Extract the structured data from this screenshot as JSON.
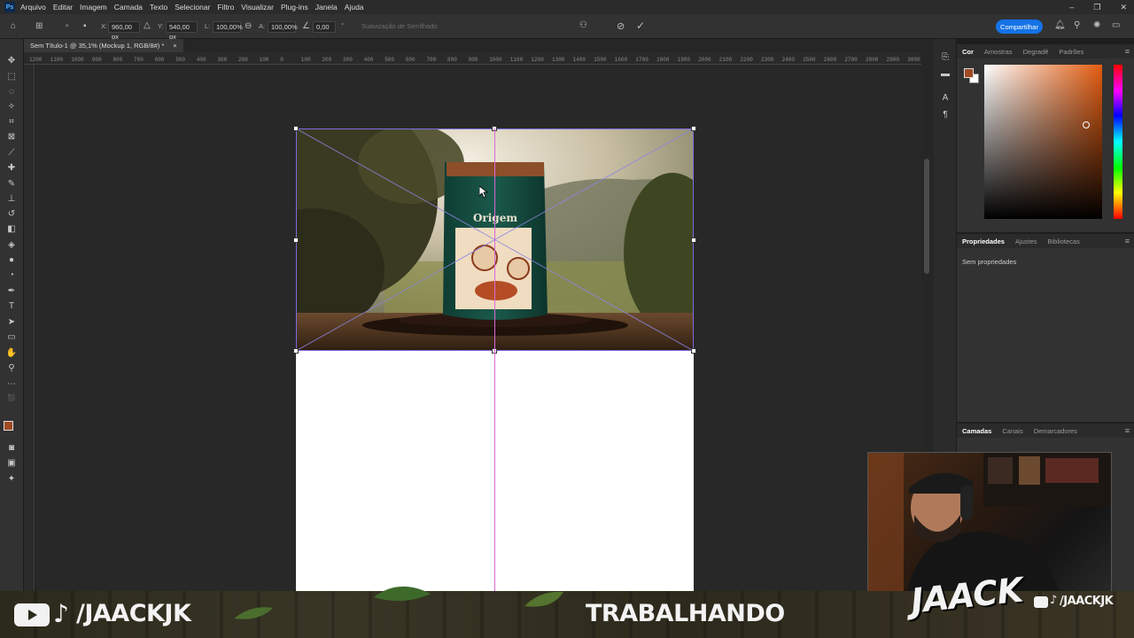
{
  "menu": {
    "logo": "Ps",
    "items": [
      "Arquivo",
      "Editar",
      "Imagem",
      "Camada",
      "Texto",
      "Selecionar",
      "Filtro",
      "Visualizar",
      "Plug-ins",
      "Janela",
      "Ajuda"
    ]
  },
  "window_controls": {
    "minimize": "–",
    "restore": "❐",
    "close": "✕"
  },
  "options": {
    "x_label": "X:",
    "x_value": "960,00 px",
    "y_label": "Y:",
    "y_value": "540,00 px",
    "w_label": "L:",
    "w_value": "100,00%",
    "h_label": "A:",
    "h_value": "100,00%",
    "angle_value": "0,00",
    "degree": "°",
    "smoothing": "Suavização de Serrilhado",
    "share": "Compartilhar"
  },
  "document": {
    "tab_title": "Sem Título-1 @ 35,1% (Mockup 1, RGB/8#) *",
    "close": "×"
  },
  "ruler_ticks": [
    "1200",
    "1100",
    "1000",
    "900",
    "800",
    "700",
    "600",
    "500",
    "400",
    "300",
    "200",
    "100",
    "0",
    "100",
    "200",
    "300",
    "400",
    "500",
    "600",
    "700",
    "800",
    "900",
    "1000",
    "1100",
    "1200",
    "1300",
    "1400",
    "1500",
    "1600",
    "1700",
    "1800",
    "1900",
    "2000",
    "2100",
    "2200",
    "2300",
    "2400",
    "2500",
    "2600",
    "2700",
    "2800",
    "2900",
    "3000"
  ],
  "product": {
    "brand": "Origem"
  },
  "color_panel": {
    "tabs": [
      "Cor",
      "Amostras",
      "Degradê",
      "Padrões"
    ],
    "fg_color": "#a04a24",
    "bg_color": "#ffffff"
  },
  "properties_panel": {
    "tabs": [
      "Propriedades",
      "Ajustes",
      "Bibliotecas"
    ],
    "empty_text": "Sem propriedades"
  },
  "layers_panel": {
    "tabs": [
      "Camadas",
      "Canais",
      "Demarcadores"
    ]
  },
  "banner": {
    "handle_left": "/JAACKJK",
    "status": "TRABALHANDO",
    "logo": "JAACK",
    "handle_right": "/JAACKJK"
  }
}
